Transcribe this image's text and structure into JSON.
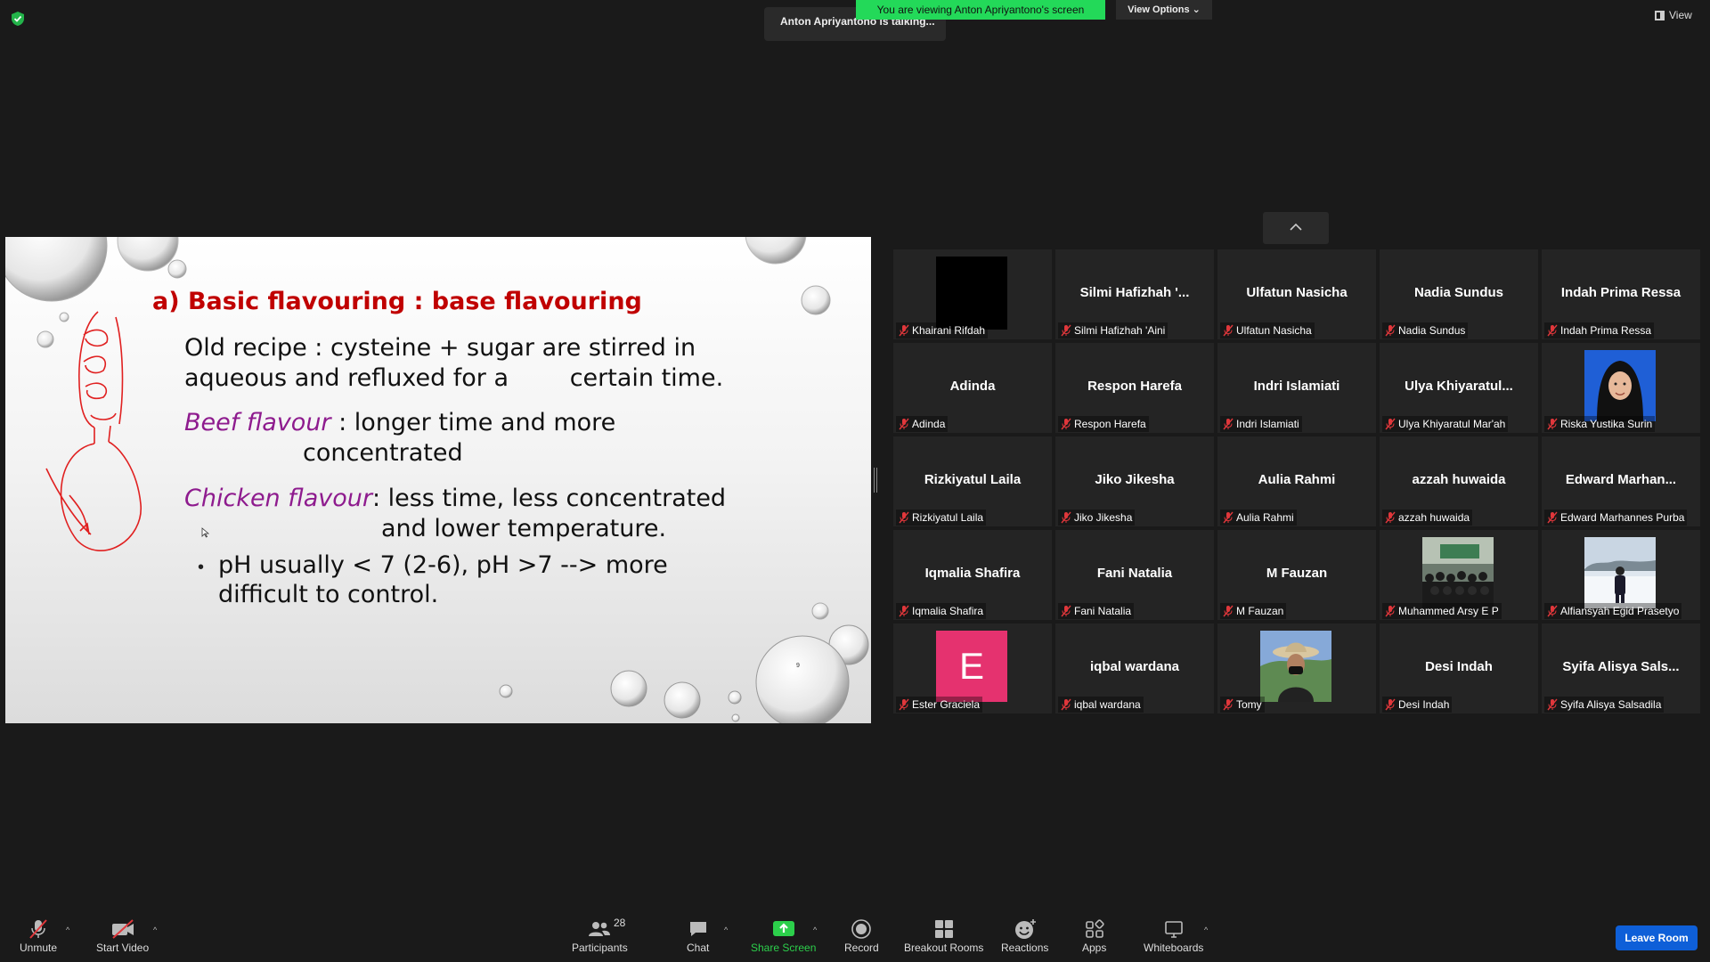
{
  "top": {
    "banner": "You are viewing Anton Apriyantono's screen",
    "view_options": "View Options",
    "talking": "Anton Apriyantono is talking...",
    "view_label": "View"
  },
  "slide": {
    "title": "a) Basic flavouring : base flavouring",
    "line1": "Old recipe : cysteine + sugar are stirred in",
    "line2": "aqueous and refluxed for a        certain time.",
    "beef_label": "Beef flavour",
    "beef_text": " : longer time and more",
    "beef_text2": "concentrated",
    "chicken_label": "Chicken flavour",
    "chicken_text": ": less time, less concentrated",
    "chicken_text2": "and lower temperature.",
    "bullet": "•",
    "ph1": "pH usually < 7 (2-6), pH >7 --> more",
    "ph2": "difficult to control.",
    "page": "9"
  },
  "participants": [
    {
      "big": "",
      "name": "Khairani Rifdah",
      "video": "black"
    },
    {
      "big": "Silmi  Hafizhah  '...",
      "name": "Silmi Hafizhah 'Aini"
    },
    {
      "big": "Ulfatun Nasicha",
      "name": "Ulfatun Nasicha"
    },
    {
      "big": "Nadia Sundus",
      "name": "Nadia Sundus"
    },
    {
      "big": "Indah Prima Ressa",
      "name": "Indah Prima Ressa"
    },
    {
      "big": "Adinda",
      "name": "Adinda"
    },
    {
      "big": "Respon Harefa",
      "name": "Respon Harefa"
    },
    {
      "big": "Indri Islamiati",
      "name": "Indri Islamiati"
    },
    {
      "big": "Ulya  Khiyaratul...",
      "name": "Ulya Khiyaratul Mar'ah"
    },
    {
      "big": "",
      "name": "Riska Yustika Surin",
      "video": "hijab-photo"
    },
    {
      "big": "Rizkiyatul Laila",
      "name": "Rizkiyatul Laila"
    },
    {
      "big": "Jiko Jikesha",
      "name": "Jiko Jikesha"
    },
    {
      "big": "Aulia Rahmi",
      "name": "Aulia Rahmi"
    },
    {
      "big": "azzah huwaida",
      "name": "azzah huwaida"
    },
    {
      "big": "Edward  Marhan...",
      "name": "Edward Marhannes Purba"
    },
    {
      "big": "Iqmalia Shafira",
      "name": "Iqmalia Shafira"
    },
    {
      "big": "Fani Natalia",
      "name": "Fani Natalia"
    },
    {
      "big": "M Fauzan",
      "name": "M Fauzan"
    },
    {
      "big": "",
      "name": "Muhammed Arsy E P",
      "video": "group-photo"
    },
    {
      "big": "",
      "name": "Alfiansyah Egid Prasetyo",
      "video": "snow-photo"
    },
    {
      "big": "",
      "name": "Ester Graciela",
      "video": "letter",
      "letter": "E"
    },
    {
      "big": "iqbal wardana",
      "name": "iqbal wardana"
    },
    {
      "big": "",
      "name": "Tomy",
      "video": "hat-photo"
    },
    {
      "big": "Desi Indah",
      "name": "Desi Indah"
    },
    {
      "big": "Syifa  Alisya  Sals...",
      "name": "Syifa Alisya Salsadila"
    }
  ],
  "toolbar": {
    "unmute": "Unmute",
    "start_video": "Start Video",
    "participants": "Participants",
    "participants_count": "28",
    "chat": "Chat",
    "share_screen": "Share Screen",
    "record": "Record",
    "breakout": "Breakout Rooms",
    "reactions": "Reactions",
    "apps": "Apps",
    "whiteboards": "Whiteboards",
    "leave": "Leave Room"
  },
  "colors": {
    "banner_green": "#23d959",
    "share_green": "#2ccf4b",
    "leave_blue": "#0e5fd8",
    "title_red": "#c00000",
    "flavour_purple": "#8e1b8e",
    "muted_red": "#e0373b"
  }
}
